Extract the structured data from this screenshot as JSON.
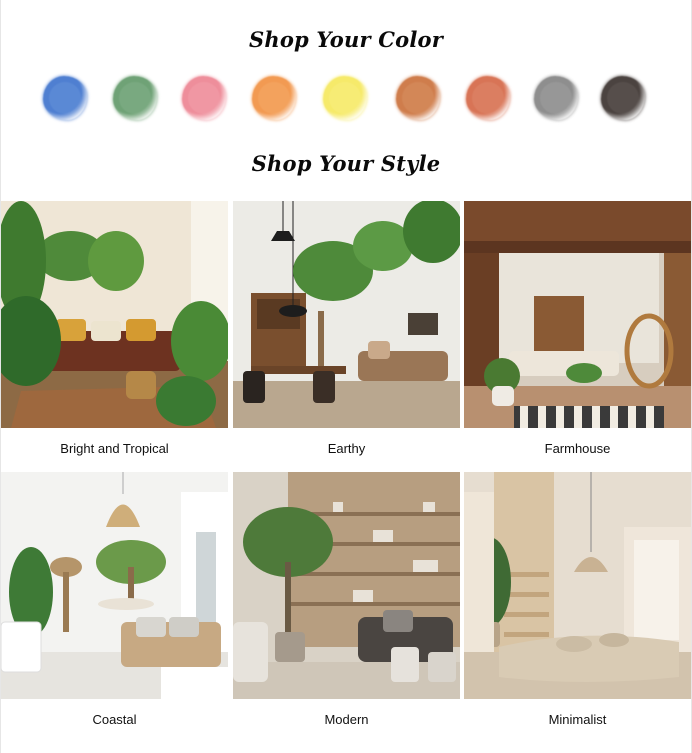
{
  "headings": {
    "color": "Shop Your Color",
    "style": "Shop Your Style"
  },
  "swatches": [
    {
      "name": "blue",
      "color": "#4f7fd1"
    },
    {
      "name": "green",
      "color": "#6fa276"
    },
    {
      "name": "pink",
      "color": "#ee8e9b"
    },
    {
      "name": "orange",
      "color": "#f29a52"
    },
    {
      "name": "yellow",
      "color": "#f6ea6a"
    },
    {
      "name": "rust",
      "color": "#cf7d4c"
    },
    {
      "name": "terracotta",
      "color": "#d87456"
    },
    {
      "name": "gray",
      "color": "#8e8e8e"
    },
    {
      "name": "charcoal",
      "color": "#4b4340"
    }
  ],
  "styles": [
    {
      "label": "Bright and Tropical"
    },
    {
      "label": "Earthy"
    },
    {
      "label": "Farmhouse"
    },
    {
      "label": "Coastal"
    },
    {
      "label": "Modern"
    },
    {
      "label": "Minimalist"
    }
  ]
}
